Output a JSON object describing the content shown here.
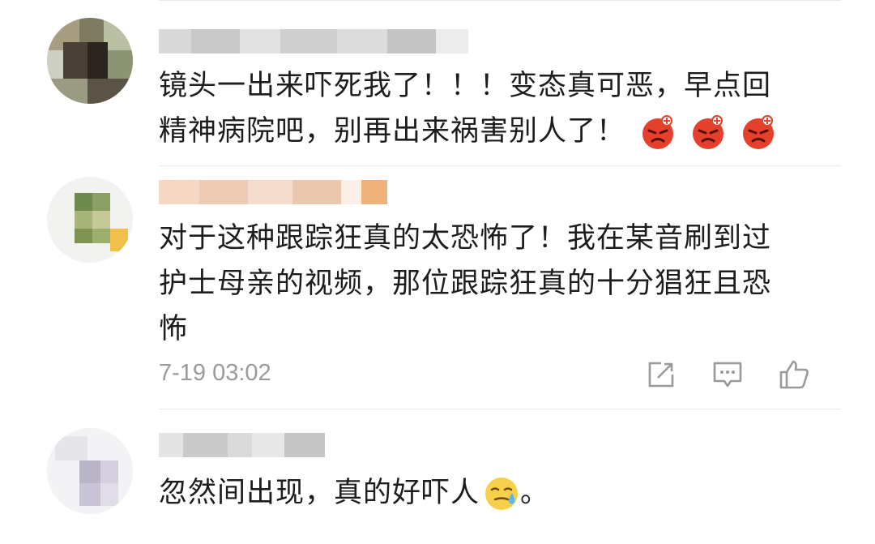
{
  "comments": [
    {
      "text_lines": [
        "镜头一出来吓死我了！！！变态真可恶，早点回",
        "精神病院吧，别再出来祸害别人了！"
      ],
      "emojis": [
        "angry-face-icon",
        "angry-face-icon",
        "angry-face-icon"
      ]
    },
    {
      "text_lines": [
        "对于这种跟踪狂真的太恐怖了！我在某音刷到过",
        "护士母亲的视频，那位跟踪狂真的十分猖狂且恐",
        "怖"
      ],
      "timestamp": "7-19 03:02",
      "actions": [
        "share-icon",
        "reply-icon",
        "like-icon"
      ]
    },
    {
      "text_lines": [
        "忽然间出现，真的好吓人"
      ],
      "trailing": "。",
      "emojis": [
        "sweat-face-icon"
      ]
    }
  ],
  "colors": {
    "accent_angry": "#e5402c",
    "divider": "#e8e8e8",
    "meta_text": "#9a9a9a"
  }
}
